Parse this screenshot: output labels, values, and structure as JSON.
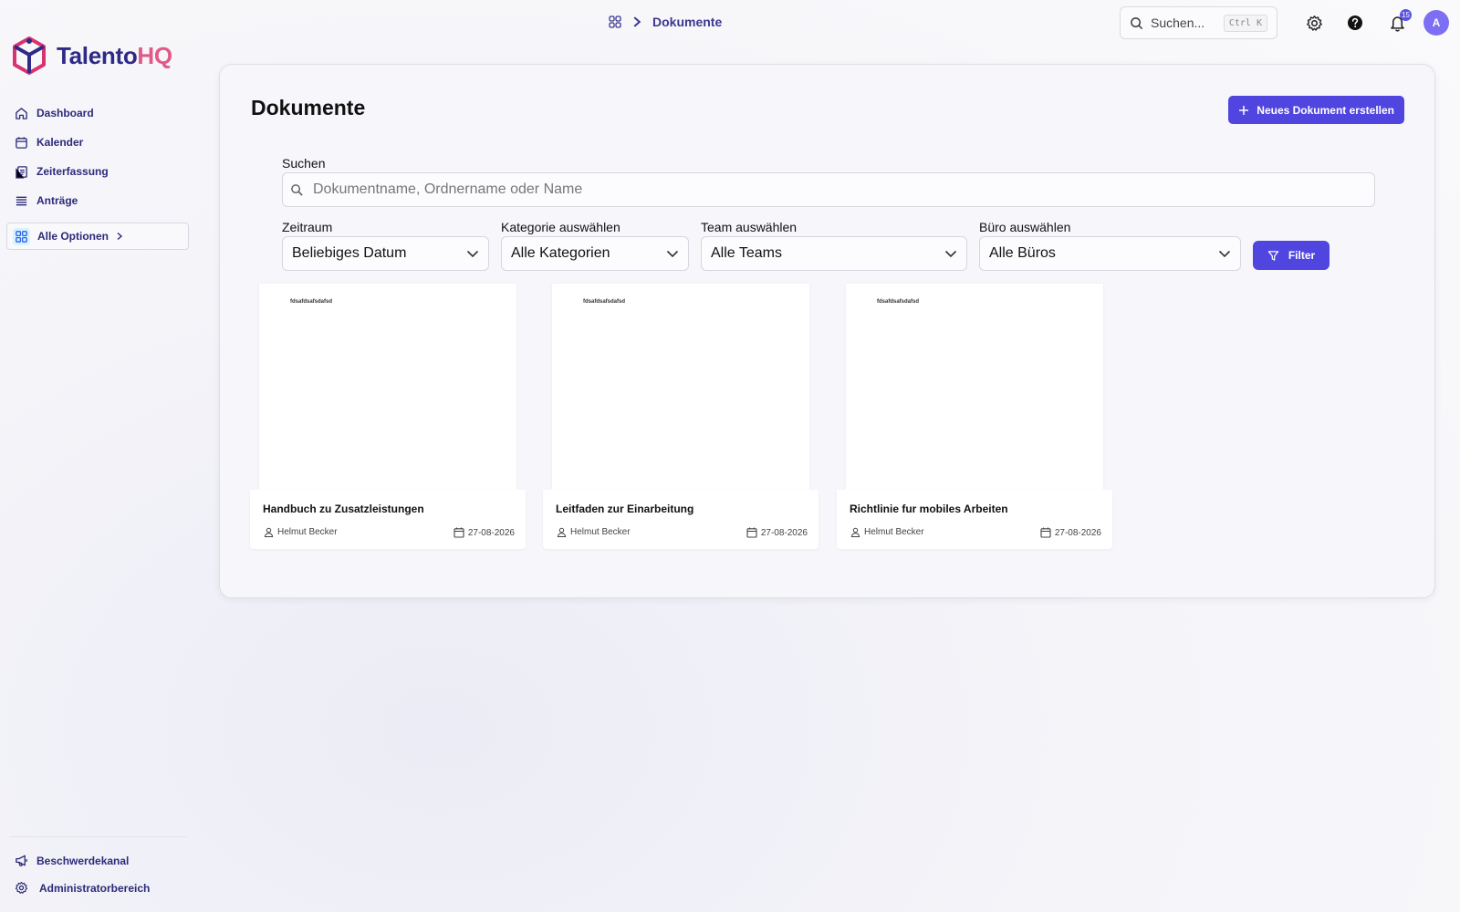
{
  "app": {
    "logo_part1": "Talento",
    "logo_part2": "HQ",
    "colors": {
      "accent": "#5145e0",
      "brand_dark": "#2f2a87",
      "brand_pink": "#e05a86"
    }
  },
  "sidebar": {
    "items": [
      {
        "label": "Dashboard",
        "icon": "home-icon"
      },
      {
        "label": "Kalender",
        "icon": "calendar-icon"
      },
      {
        "label": "Zeiterfassung",
        "icon": "clipboard-icon"
      },
      {
        "label": "Anträge",
        "icon": "list-icon"
      }
    ],
    "all_options": "Alle Optionen",
    "bottom": [
      {
        "label": "Beschwerdekanal",
        "icon": "megaphone-icon"
      },
      {
        "label": "Administratorbereich",
        "icon": "gear-icon"
      }
    ]
  },
  "topbar": {
    "breadcrumb_current": "Dokumente",
    "search_placeholder": "Suchen...",
    "search_shortcut": "Ctrl K",
    "notification_count": "15",
    "avatar_initial": "A"
  },
  "main": {
    "title": "Dokumente",
    "new_button": "Neues Dokument erstellen",
    "search_label": "Suchen",
    "search_placeholder": "Dokumentname, Ordnername oder Name",
    "filters": [
      {
        "label": "Zeitraum",
        "value": "Beliebiges Datum"
      },
      {
        "label": "Kategorie auswählen",
        "value": "Alle Kategorien"
      },
      {
        "label": "Team auswählen",
        "value": "Alle Teams"
      },
      {
        "label": "Büro auswählen",
        "value": "Alle Büros"
      }
    ],
    "filter_button": "Filter",
    "documents": [
      {
        "preview_text": "fdsafdsafsdafsd",
        "title": "Handbuch zu Zusatzleistungen",
        "author": "Helmut Becker",
        "date": "27-08-2026"
      },
      {
        "preview_text": "fdsafdsafsdafsd",
        "title": "Leitfaden zur Einarbeitung",
        "author": "Helmut Becker",
        "date": "27-08-2026"
      },
      {
        "preview_text": "fdsafdsafsdafsd",
        "title": "Richtlinie fur mobiles Arbeiten",
        "author": "Helmut Becker",
        "date": "27-08-2026"
      }
    ]
  }
}
